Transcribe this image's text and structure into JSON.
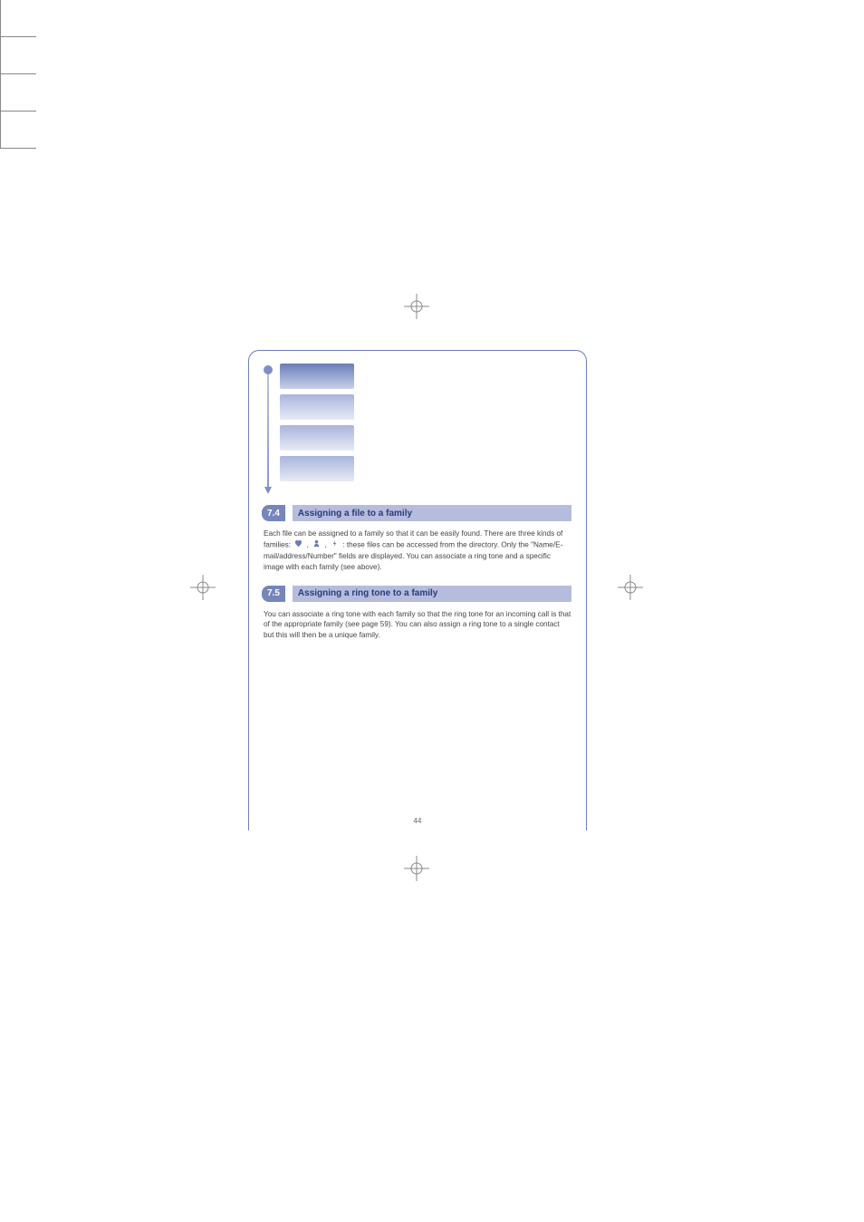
{
  "sections": [
    {
      "number": "7.4",
      "title": "Assigning a file to a family",
      "body_parts": [
        "Each file can be assigned to a family so that it can be easily found. There are three kinds of families:",
        ": these files can be accessed from the directory. Only the \"Name/E-mail/address/Number\" fields are displayed. You can associate a ring tone and a specific image with each family (see above)."
      ],
      "icons": [
        "heart",
        "person",
        "bolt"
      ]
    },
    {
      "number": "7.5",
      "title": "Assigning a ring tone to a family",
      "body": "You can associate a ring tone with each family so that the ring tone for an incoming call is that of the appropriate family (see page 59). You can also assign a ring tone to a single contact but this will then be a unique family."
    }
  ],
  "page_number": "44"
}
